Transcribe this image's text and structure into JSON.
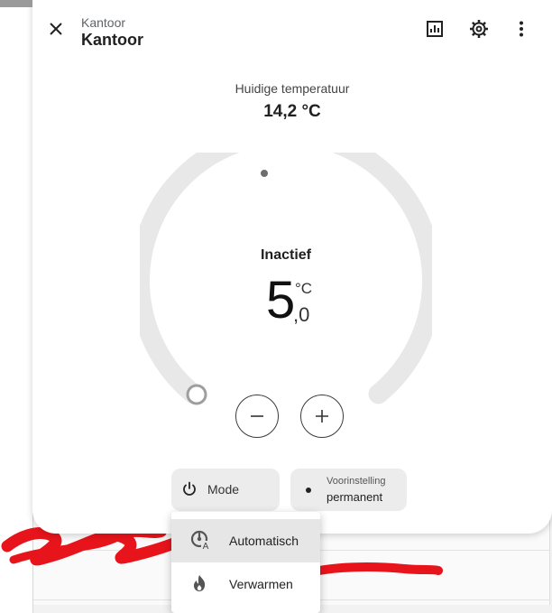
{
  "header": {
    "subtitle": "Kantoor",
    "title": "Kantoor"
  },
  "current": {
    "label": "Huidige temperatuur",
    "value": "14,2 °C"
  },
  "target": {
    "state": "Inactief",
    "integer": "5",
    "decimal": ",0",
    "unit": "°C"
  },
  "mode": {
    "label": "Mode"
  },
  "preset": {
    "sublabel": "Voorinstelling",
    "value": "permanent"
  },
  "menu": {
    "items": [
      {
        "label": "Automatisch",
        "icon": "thermostat-auto-icon",
        "selected": true
      },
      {
        "label": "Verwarmen",
        "icon": "fire-icon",
        "selected": false
      }
    ]
  },
  "colors": {
    "track": "#e8e8e8",
    "scribble": "#e8141b"
  }
}
